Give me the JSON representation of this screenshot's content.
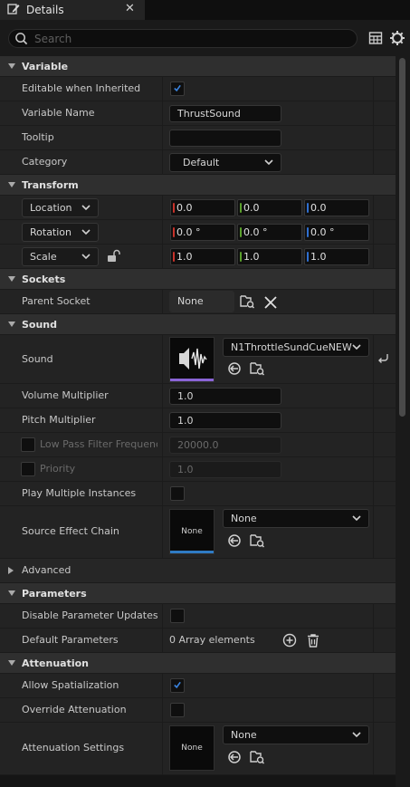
{
  "tab": {
    "title": "Details",
    "close": "✕"
  },
  "search": {
    "placeholder": "Search",
    "value": ""
  },
  "colors": {
    "accent": "#3a84e0",
    "sound_bar": "#8a64d6",
    "source_bar": "#2f7bc4",
    "x_axis": "#c8322a",
    "y_axis": "#5aa02c",
    "z_axis": "#2f6fd0"
  },
  "sections": {
    "variable": {
      "label": "Variable",
      "editable_label": "Editable when Inherited",
      "editable_checked": true,
      "name_label": "Variable Name",
      "name_value": "ThrustSound",
      "tooltip_label": "Tooltip",
      "tooltip_value": "",
      "category_label": "Category",
      "category_value": "Default"
    },
    "transform": {
      "label": "Transform",
      "location": {
        "label": "Location",
        "x": "0.0",
        "y": "0.0",
        "z": "0.0"
      },
      "rotation": {
        "label": "Rotation",
        "x": "0.0 °",
        "y": "0.0 °",
        "z": "0.0 °"
      },
      "scale": {
        "label": "Scale",
        "x": "1.0",
        "y": "1.0",
        "z": "1.0"
      }
    },
    "sockets": {
      "label": "Sockets",
      "parent_label": "Parent Socket",
      "parent_value": "None"
    },
    "sound": {
      "label": "Sound",
      "sound_label": "Sound",
      "sound_asset": "N1ThrottleSundCueNEW",
      "volume_label": "Volume Multiplier",
      "volume_value": "1.0",
      "pitch_label": "Pitch Multiplier",
      "pitch_value": "1.0",
      "lowpass_label": "Low Pass Filter Frequency",
      "lowpass_value": "20000.0",
      "priority_label": "Priority",
      "priority_value": "1.0",
      "play_multi_label": "Play Multiple Instances",
      "source_effect_label": "Source Effect Chain",
      "source_effect_thumb": "None",
      "source_effect_value": "None",
      "advanced_label": "Advanced"
    },
    "parameters": {
      "label": "Parameters",
      "disable_label": "Disable Parameter Updates While Playing",
      "default_label": "Default Parameters",
      "default_value": "0 Array elements"
    },
    "attenuation": {
      "label": "Attenuation",
      "allow_label": "Allow Spatialization",
      "allow_checked": true,
      "override_label": "Override Attenuation",
      "settings_label": "Attenuation Settings",
      "settings_thumb": "None",
      "settings_value": "None"
    }
  }
}
